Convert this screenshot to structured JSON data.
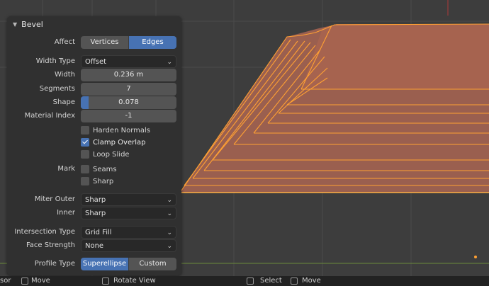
{
  "panel": {
    "title": "Bevel",
    "affect": {
      "label": "Affect",
      "options": [
        "Vertices",
        "Edges"
      ],
      "selected": "Edges"
    },
    "width_type": {
      "label": "Width Type",
      "value": "Offset"
    },
    "width": {
      "label": "Width",
      "value": "0.236 m"
    },
    "segments": {
      "label": "Segments",
      "value": "7"
    },
    "shape": {
      "label": "Shape",
      "value": "0.078",
      "level": 0.078
    },
    "material_index": {
      "label": "Material Index",
      "value": "-1"
    },
    "harden_normals": {
      "label": "Harden Normals",
      "checked": false
    },
    "clamp_overlap": {
      "label": "Clamp Overlap",
      "checked": true
    },
    "loop_slide": {
      "label": "Loop Slide",
      "checked": false
    },
    "mark": {
      "label": "Mark",
      "seams": {
        "label": "Seams",
        "checked": false
      },
      "sharp": {
        "label": "Sharp",
        "checked": false
      }
    },
    "miter_outer": {
      "label": "Miter Outer",
      "value": "Sharp"
    },
    "inner": {
      "label": "Inner",
      "value": "Sharp"
    },
    "intersection_type": {
      "label": "Intersection Type",
      "value": "Grid Fill"
    },
    "face_strength": {
      "label": "Face Strength",
      "value": "None"
    },
    "profile_type": {
      "label": "Profile Type",
      "options": [
        "Superellipse",
        "Custom"
      ],
      "selected": "Superellipse"
    }
  },
  "status_bar": {
    "items": [
      "sor",
      "Move",
      "Rotate View",
      "Select",
      "Move"
    ]
  },
  "colors": {
    "accent": "#4772b3",
    "mesh_face": "#a0604e",
    "mesh_edge": "#ffa033"
  },
  "icons": [
    "collapse-triangle-icon",
    "chevron-down-icon",
    "checkmark-icon",
    "mouse-button-icon"
  ]
}
